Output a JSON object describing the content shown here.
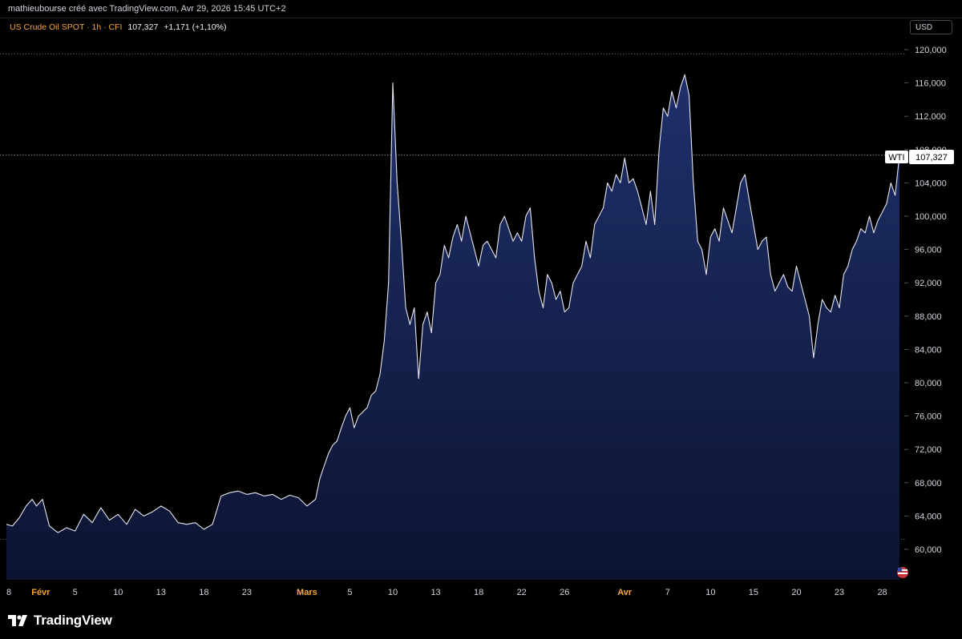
{
  "header": {
    "caption": "mathieubourse créé avec TradingView.com, Avr 29, 2026 15:45 UTC+2"
  },
  "legend": {
    "symbol": "US Crude Oil SPOT · 1h · CFI",
    "last": "107,327",
    "change": "+1,171 (+1,10%)"
  },
  "currency_button": "USD",
  "price_tag": {
    "label": "WTI",
    "value": "107,327"
  },
  "brand": {
    "name": "TradingView",
    "icon": "tradingview-logo-icon"
  },
  "colors": {
    "background": "#000000",
    "line": "#e6e6f0",
    "area_top": "#1d2d64",
    "area_bottom": "#0d1430",
    "month_label": "#f7a531",
    "axis_text": "#d1d4dc"
  },
  "chart_data": {
    "type": "area",
    "title": "US Crude Oil SPOT · 1h · CFI",
    "ylim": [
      56000,
      122000
    ],
    "y_ticks": [
      {
        "value": 60000,
        "label": "60,000"
      },
      {
        "value": 64000,
        "label": "64,000"
      },
      {
        "value": 68000,
        "label": "68,000"
      },
      {
        "value": 72000,
        "label": "72,000"
      },
      {
        "value": 76000,
        "label": "76,000"
      },
      {
        "value": 80000,
        "label": "80,000"
      },
      {
        "value": 84000,
        "label": "84,000"
      },
      {
        "value": 88000,
        "label": "88,000"
      },
      {
        "value": 92000,
        "label": "92,000"
      },
      {
        "value": 96000,
        "label": "96,000"
      },
      {
        "value": 100000,
        "label": "100,000"
      },
      {
        "value": 104000,
        "label": "104,000"
      },
      {
        "value": 108000,
        "label": "108,000"
      },
      {
        "value": 112000,
        "label": "112,000"
      },
      {
        "value": 116000,
        "label": "116,000"
      },
      {
        "value": 120000,
        "label": "120,000"
      }
    ],
    "x_ticks": [
      {
        "t": 0,
        "label": "8",
        "month": false
      },
      {
        "t": 4,
        "label": "Févr",
        "month": true
      },
      {
        "t": 8,
        "label": "5",
        "month": false
      },
      {
        "t": 13,
        "label": "10",
        "month": false
      },
      {
        "t": 18,
        "label": "13",
        "month": false
      },
      {
        "t": 23,
        "label": "18",
        "month": false
      },
      {
        "t": 28,
        "label": "23",
        "month": false
      },
      {
        "t": 35,
        "label": "Mars",
        "month": true
      },
      {
        "t": 40,
        "label": "5",
        "month": false
      },
      {
        "t": 45,
        "label": "10",
        "month": false
      },
      {
        "t": 50,
        "label": "13",
        "month": false
      },
      {
        "t": 55,
        "label": "18",
        "month": false
      },
      {
        "t": 60,
        "label": "22",
        "month": false
      },
      {
        "t": 65,
        "label": "26",
        "month": false
      },
      {
        "t": 72,
        "label": "Avr",
        "month": true
      },
      {
        "t": 77,
        "label": "7",
        "month": false
      },
      {
        "t": 82,
        "label": "10",
        "month": false
      },
      {
        "t": 87,
        "label": "15",
        "month": false
      },
      {
        "t": 92,
        "label": "20",
        "month": false
      },
      {
        "t": 97,
        "label": "23",
        "month": false
      },
      {
        "t": 102,
        "label": "28",
        "month": false
      }
    ],
    "x_range": [
      0,
      104
    ],
    "series": [
      {
        "values": [
          [
            0,
            63000
          ],
          [
            0.7,
            62800
          ],
          [
            1.5,
            63800
          ],
          [
            2.3,
            65200
          ],
          [
            3,
            66000
          ],
          [
            3.5,
            65200
          ],
          [
            4.2,
            66000
          ],
          [
            5,
            62800
          ],
          [
            6,
            62000
          ],
          [
            7,
            62600
          ],
          [
            8,
            62200
          ],
          [
            9,
            64200
          ],
          [
            10,
            63200
          ],
          [
            11,
            65000
          ],
          [
            12,
            63500
          ],
          [
            13,
            64200
          ],
          [
            14,
            63000
          ],
          [
            15,
            64800
          ],
          [
            16,
            64000
          ],
          [
            17,
            64500
          ],
          [
            18,
            65200
          ],
          [
            19,
            64600
          ],
          [
            20,
            63200
          ],
          [
            21,
            63000
          ],
          [
            22,
            63200
          ],
          [
            23,
            62400
          ],
          [
            24,
            63000
          ],
          [
            25,
            66400
          ],
          [
            26,
            66800
          ],
          [
            27,
            67000
          ],
          [
            28,
            66600
          ],
          [
            29,
            66800
          ],
          [
            30,
            66400
          ],
          [
            31,
            66600
          ],
          [
            32,
            66000
          ],
          [
            33,
            66500
          ],
          [
            34,
            66200
          ],
          [
            35,
            65200
          ],
          [
            36,
            66000
          ],
          [
            36.5,
            68500
          ],
          [
            37,
            70000
          ],
          [
            37.5,
            71500
          ],
          [
            38,
            72500
          ],
          [
            38.5,
            73000
          ],
          [
            39,
            74600
          ],
          [
            39.5,
            76000
          ],
          [
            40,
            77000
          ],
          [
            40.5,
            74600
          ],
          [
            41,
            76000
          ],
          [
            42,
            77000
          ],
          [
            42.5,
            78500
          ],
          [
            43,
            79000
          ],
          [
            43.5,
            81000
          ],
          [
            44,
            85000
          ],
          [
            44.5,
            92000
          ],
          [
            45,
            116000
          ],
          [
            45.5,
            104000
          ],
          [
            46,
            97000
          ],
          [
            46.5,
            89000
          ],
          [
            47,
            87000
          ],
          [
            47.5,
            89000
          ],
          [
            48,
            80500
          ],
          [
            48.5,
            87000
          ],
          [
            49,
            88500
          ],
          [
            49.5,
            86000
          ],
          [
            50,
            92000
          ],
          [
            50.5,
            93000
          ],
          [
            51,
            96500
          ],
          [
            51.5,
            95000
          ],
          [
            52,
            97500
          ],
          [
            52.5,
            99000
          ],
          [
            53,
            97000
          ],
          [
            53.5,
            100000
          ],
          [
            54,
            98000
          ],
          [
            55,
            94000
          ],
          [
            55.5,
            96500
          ],
          [
            56,
            97000
          ],
          [
            57,
            95000
          ],
          [
            57.5,
            99000
          ],
          [
            58,
            100000
          ],
          [
            59,
            97000
          ],
          [
            59.5,
            98000
          ],
          [
            60,
            97000
          ],
          [
            60.5,
            100000
          ],
          [
            61,
            101000
          ],
          [
            61.5,
            95000
          ],
          [
            62,
            91000
          ],
          [
            62.5,
            89000
          ],
          [
            63,
            93000
          ],
          [
            63.5,
            92000
          ],
          [
            64,
            90000
          ],
          [
            64.5,
            91000
          ],
          [
            65,
            88500
          ],
          [
            65.5,
            89000
          ],
          [
            66,
            92000
          ],
          [
            67,
            94000
          ],
          [
            67.5,
            97000
          ],
          [
            68,
            95000
          ],
          [
            68.5,
            99000
          ],
          [
            69,
            100000
          ],
          [
            69.5,
            101000
          ],
          [
            70,
            104000
          ],
          [
            70.5,
            103000
          ],
          [
            71,
            105000
          ],
          [
            71.5,
            104000
          ],
          [
            72,
            107000
          ],
          [
            72.5,
            104000
          ],
          [
            73,
            104500
          ],
          [
            73.5,
            103000
          ],
          [
            74,
            101000
          ],
          [
            74.5,
            99000
          ],
          [
            75,
            103000
          ],
          [
            75.5,
            99000
          ],
          [
            76,
            108000
          ],
          [
            76.5,
            113000
          ],
          [
            77,
            112000
          ],
          [
            77.5,
            115000
          ],
          [
            78,
            113000
          ],
          [
            78.5,
            115500
          ],
          [
            79,
            117000
          ],
          [
            79.5,
            114500
          ],
          [
            80,
            104000
          ],
          [
            80.5,
            97000
          ],
          [
            81,
            96000
          ],
          [
            81.5,
            93000
          ],
          [
            82,
            97500
          ],
          [
            82.5,
            98500
          ],
          [
            83,
            97000
          ],
          [
            83.5,
            101000
          ],
          [
            84,
            99500
          ],
          [
            84.5,
            98000
          ],
          [
            85,
            101000
          ],
          [
            85.5,
            104000
          ],
          [
            86,
            105000
          ],
          [
            86.5,
            102000
          ],
          [
            87,
            99000
          ],
          [
            87.5,
            96000
          ],
          [
            88,
            97000
          ],
          [
            88.5,
            97500
          ],
          [
            89,
            93000
          ],
          [
            89.5,
            91000
          ],
          [
            90,
            92000
          ],
          [
            90.5,
            93000
          ],
          [
            91,
            91500
          ],
          [
            91.5,
            91000
          ],
          [
            92,
            94000
          ],
          [
            92.5,
            92000
          ],
          [
            93,
            90000
          ],
          [
            93.5,
            88000
          ],
          [
            94,
            83000
          ],
          [
            94.5,
            87000
          ],
          [
            95,
            90000
          ],
          [
            95.5,
            89000
          ],
          [
            96,
            88500
          ],
          [
            96.5,
            90500
          ],
          [
            97,
            89000
          ],
          [
            97.5,
            93000
          ],
          [
            98,
            94000
          ],
          [
            98.5,
            96000
          ],
          [
            99,
            97000
          ],
          [
            99.5,
            98500
          ],
          [
            100,
            98000
          ],
          [
            100.5,
            100000
          ],
          [
            101,
            98000
          ],
          [
            101.5,
            99500
          ],
          [
            102,
            100500
          ],
          [
            102.5,
            101500
          ],
          [
            103,
            104000
          ],
          [
            103.5,
            102500
          ],
          [
            104,
            107327
          ]
        ]
      }
    ],
    "last_value": 107327,
    "reference_lines": [
      119500,
      61200,
      107327
    ]
  }
}
